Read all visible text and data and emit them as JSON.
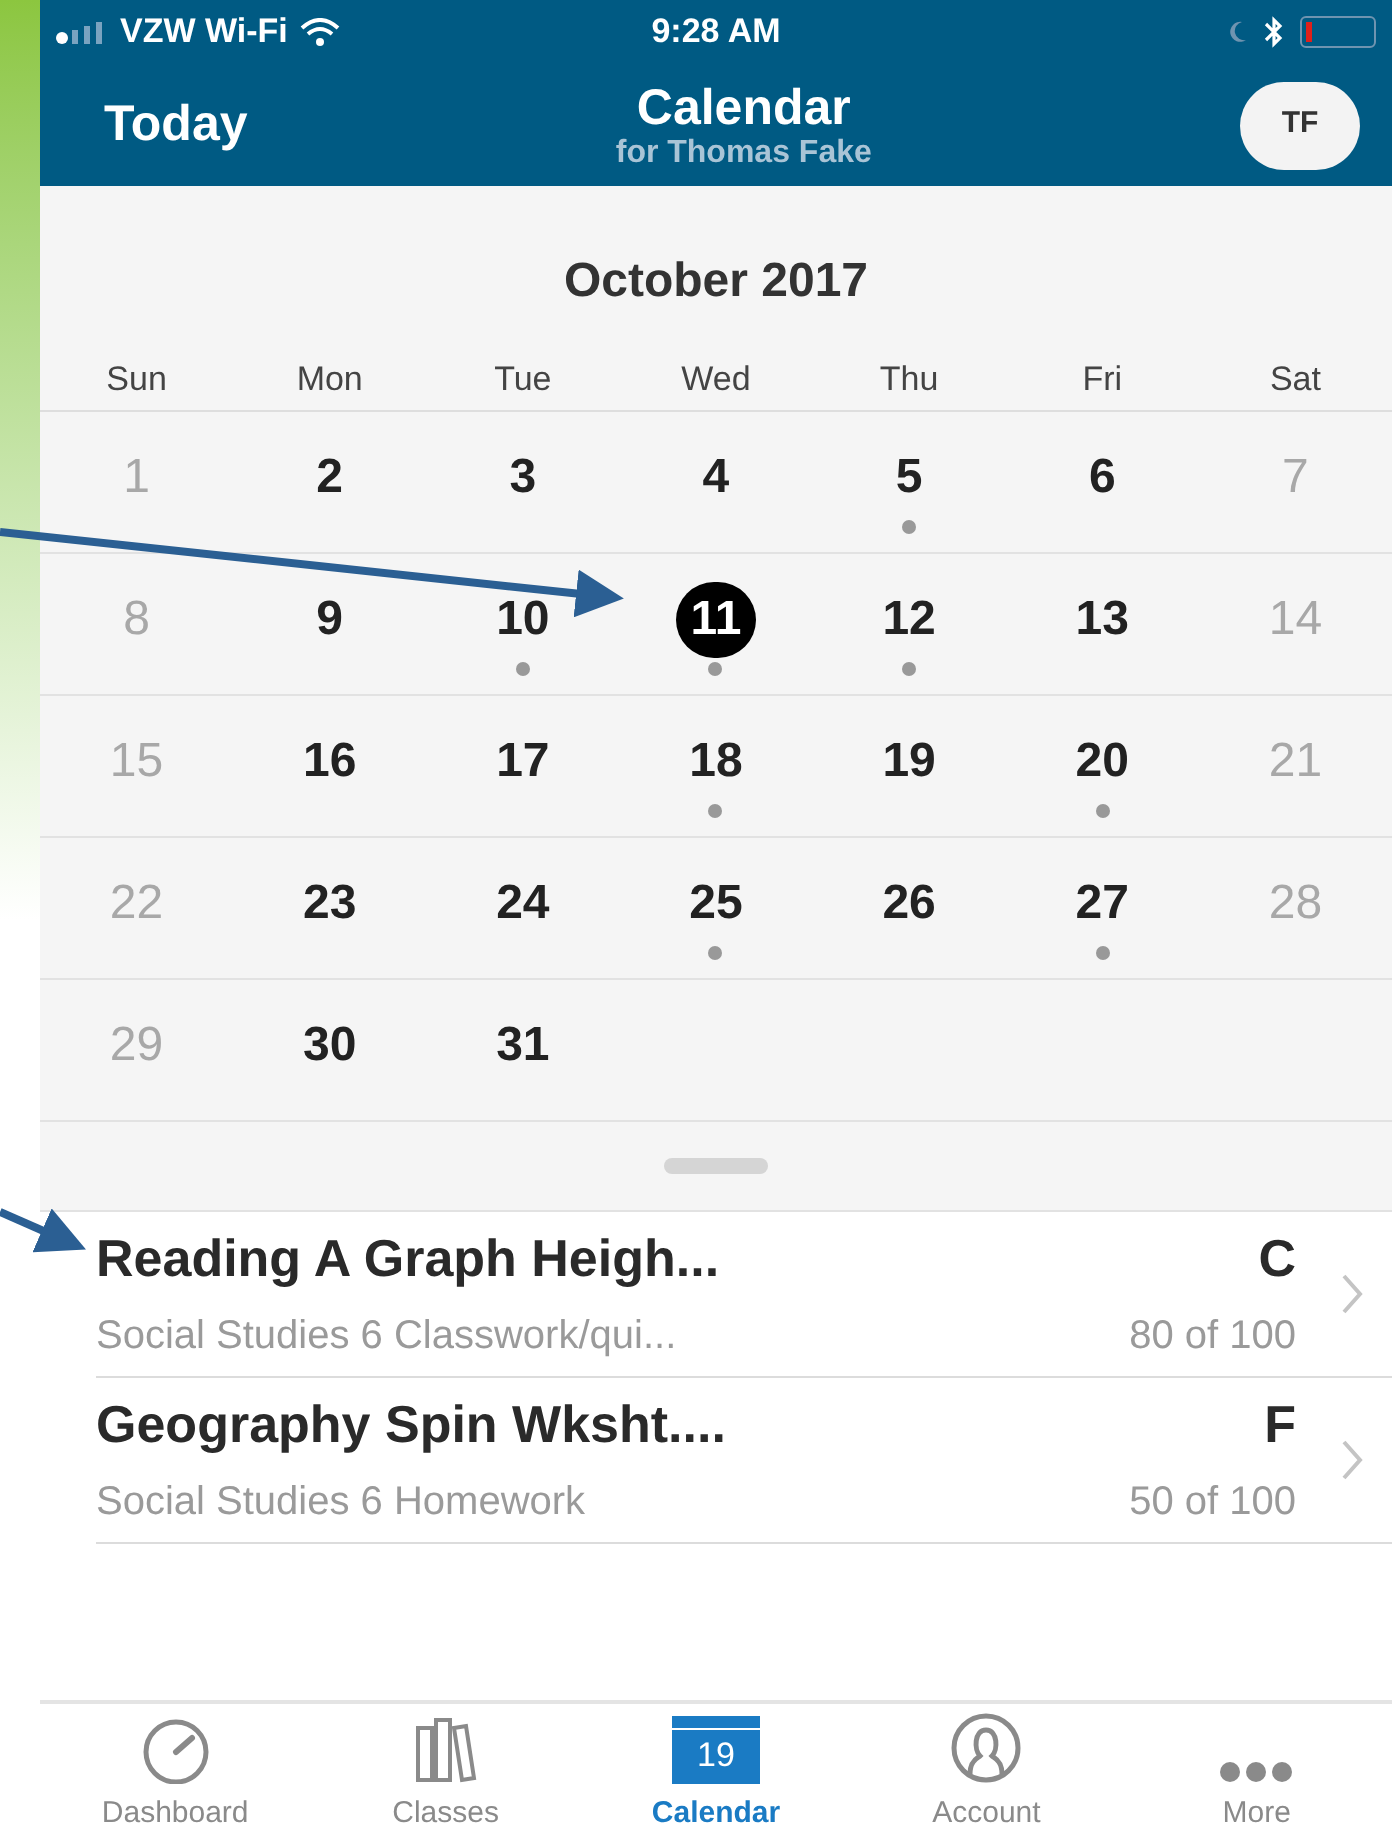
{
  "status_bar": {
    "carrier": "VZW Wi-Fi",
    "time": "9:28 AM"
  },
  "nav": {
    "left": "Today",
    "title": "Calendar",
    "subtitle": "for Thomas Fake",
    "avatar": "TF"
  },
  "calendar": {
    "month": "October 2017",
    "weekdays": [
      "Sun",
      "Mon",
      "Tue",
      "Wed",
      "Thu",
      "Fri",
      "Sat"
    ],
    "days": [
      {
        "label": "1",
        "muted": true,
        "has_event": false,
        "selected": false
      },
      {
        "label": "2",
        "muted": false,
        "has_event": false,
        "selected": false
      },
      {
        "label": "3",
        "muted": false,
        "has_event": false,
        "selected": false
      },
      {
        "label": "4",
        "muted": false,
        "has_event": false,
        "selected": false
      },
      {
        "label": "5",
        "muted": false,
        "has_event": true,
        "selected": false
      },
      {
        "label": "6",
        "muted": false,
        "has_event": false,
        "selected": false
      },
      {
        "label": "7",
        "muted": true,
        "has_event": false,
        "selected": false
      },
      {
        "label": "8",
        "muted": true,
        "has_event": false,
        "selected": false
      },
      {
        "label": "9",
        "muted": false,
        "has_event": false,
        "selected": false
      },
      {
        "label": "10",
        "muted": false,
        "has_event": true,
        "selected": false
      },
      {
        "label": "11",
        "muted": false,
        "has_event": true,
        "selected": true
      },
      {
        "label": "12",
        "muted": false,
        "has_event": true,
        "selected": false
      },
      {
        "label": "13",
        "muted": false,
        "has_event": false,
        "selected": false
      },
      {
        "label": "14",
        "muted": true,
        "has_event": false,
        "selected": false
      },
      {
        "label": "15",
        "muted": true,
        "has_event": false,
        "selected": false
      },
      {
        "label": "16",
        "muted": false,
        "has_event": false,
        "selected": false
      },
      {
        "label": "17",
        "muted": false,
        "has_event": false,
        "selected": false
      },
      {
        "label": "18",
        "muted": false,
        "has_event": true,
        "selected": false
      },
      {
        "label": "19",
        "muted": false,
        "has_event": false,
        "selected": false
      },
      {
        "label": "20",
        "muted": false,
        "has_event": true,
        "selected": false
      },
      {
        "label": "21",
        "muted": true,
        "has_event": false,
        "selected": false
      },
      {
        "label": "22",
        "muted": true,
        "has_event": false,
        "selected": false
      },
      {
        "label": "23",
        "muted": false,
        "has_event": false,
        "selected": false
      },
      {
        "label": "24",
        "muted": false,
        "has_event": false,
        "selected": false
      },
      {
        "label": "25",
        "muted": false,
        "has_event": true,
        "selected": false
      },
      {
        "label": "26",
        "muted": false,
        "has_event": false,
        "selected": false
      },
      {
        "label": "27",
        "muted": false,
        "has_event": true,
        "selected": false
      },
      {
        "label": "28",
        "muted": true,
        "has_event": false,
        "selected": false
      },
      {
        "label": "29",
        "muted": true,
        "has_event": false,
        "selected": false
      },
      {
        "label": "30",
        "muted": false,
        "has_event": false,
        "selected": false
      },
      {
        "label": "31",
        "muted": false,
        "has_event": false,
        "selected": false
      }
    ]
  },
  "assignments": [
    {
      "title": "Reading A Graph Heigh...",
      "course": "Social Studies 6 Classwork/qui...",
      "grade": "C",
      "score": "80 of 100"
    },
    {
      "title": "Geography Spin Wksht....",
      "course": "Social Studies 6 Homework",
      "grade": "F",
      "score": "50 of 100"
    }
  ],
  "tab_bar": [
    {
      "kind": "dashboard",
      "label": "Dashboard",
      "selected": false
    },
    {
      "kind": "classes",
      "label": "Classes",
      "selected": false
    },
    {
      "kind": "calendar",
      "label": "Calendar",
      "selected": true,
      "icon_text": "19"
    },
    {
      "kind": "account",
      "label": "Account",
      "selected": false
    },
    {
      "kind": "more",
      "label": "More",
      "selected": false
    }
  ]
}
